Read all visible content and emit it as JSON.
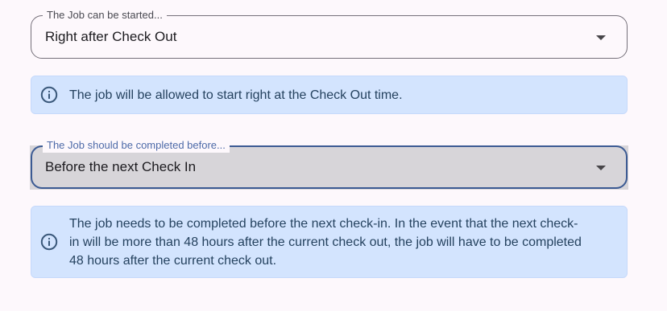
{
  "start_field": {
    "label": "The Job can be started...",
    "value": "Right after Check Out",
    "caret_icon": "caret-down-icon"
  },
  "start_info": {
    "icon": "info-icon",
    "text": "The job will be allowed to start right at the Check Out time."
  },
  "complete_field": {
    "label": "The Job should be completed before...",
    "value": "Before the next Check In",
    "caret_icon": "caret-down-icon"
  },
  "complete_info": {
    "icon": "info-icon",
    "line1": "The job needs to be completed before the next check-in. In the event that the next check-",
    "line2": "in will be more than 48 hours after the current check out, the job will have to be completed",
    "line3": "48 hours after the current check out."
  },
  "colors": {
    "page_background": "#fdf8fc",
    "alert_background": "#d3e4fe",
    "alert_text": "#25425f",
    "focused_border": "#3b5a93",
    "outline": "#75707a"
  }
}
